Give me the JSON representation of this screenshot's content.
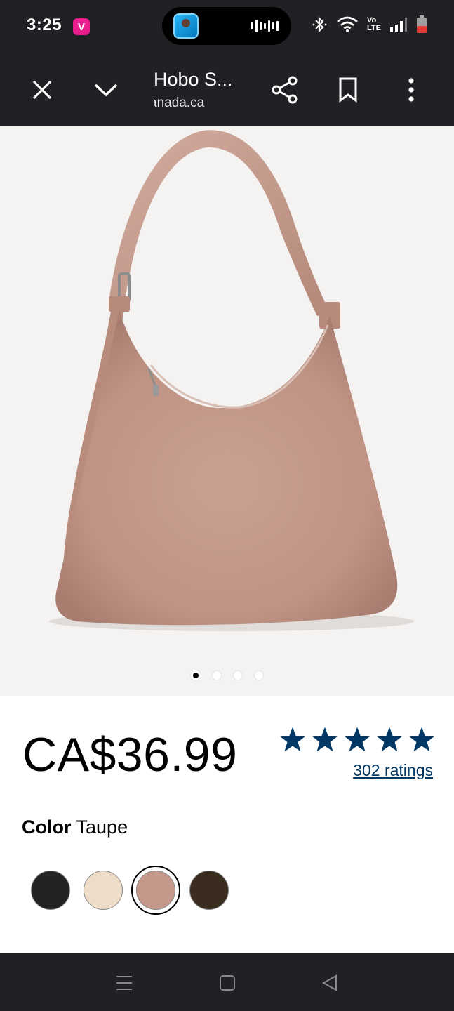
{
  "status_bar": {
    "time": "3:25",
    "app_badge": "V",
    "network_label_top": "Vo",
    "network_label_bottom": "LTE"
  },
  "toolbar": {
    "title": "Hobo S...",
    "url": "anada.ca"
  },
  "gallery": {
    "current_index": 1,
    "total": 4
  },
  "product": {
    "price": "CA$36.99",
    "rating": 5,
    "ratings_link": "302 ratings",
    "color_label": "Color",
    "color_value": "Taupe",
    "swatches": [
      {
        "name": "Black",
        "color": "#232323"
      },
      {
        "name": "Cream",
        "color": "#ecdcc8"
      },
      {
        "name": "Taupe",
        "color": "#c4988a"
      },
      {
        "name": "Brown",
        "color": "#3b2c20"
      }
    ],
    "selected_swatch": "Taupe"
  },
  "colors": {
    "system_bar": "#202124",
    "star": "#003764",
    "link": "#003764",
    "bag": "#c49a8a",
    "hero_bg": "#f4f3f2"
  }
}
